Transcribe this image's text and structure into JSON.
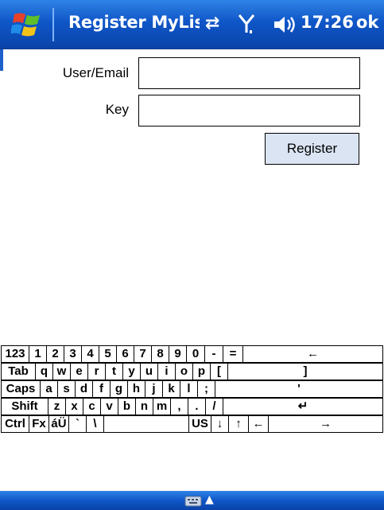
{
  "title_bar": {
    "app_title": "Register MyLis",
    "clock": "17:26",
    "ok_label": "ok",
    "icons": [
      "windows-start-icon",
      "sync-icon",
      "signal-icon",
      "volume-icon"
    ]
  },
  "form": {
    "user_label": "User/Email",
    "user_value": "",
    "key_label": "Key",
    "key_value": "",
    "register_label": "Register"
  },
  "keyboard": {
    "rows": [
      [
        "123",
        "1",
        "2",
        "3",
        "4",
        "5",
        "6",
        "7",
        "8",
        "9",
        "0",
        "-",
        "=",
        "←"
      ],
      [
        "Tab",
        "q",
        "w",
        "e",
        "r",
        "t",
        "y",
        "u",
        "i",
        "o",
        "p",
        "[",
        "]"
      ],
      [
        "Caps",
        "a",
        "s",
        "d",
        "f",
        "g",
        "h",
        "j",
        "k",
        "l",
        ";",
        "'"
      ],
      [
        "Shift",
        "z",
        "x",
        "c",
        "v",
        "b",
        "n",
        "m",
        ",",
        ".",
        "/",
        "↵"
      ],
      [
        "Ctrl",
        "Fx",
        "áÜ",
        "`",
        "\\",
        "",
        "US",
        "↓",
        "↑",
        "←",
        "→"
      ]
    ]
  },
  "menu_bar": {
    "arrow": "▲",
    "icons": [
      "keyboard-icon"
    ]
  },
  "colors": {
    "titlebar_blue": "#0f56c8",
    "button_face": "#dbe4f3"
  }
}
